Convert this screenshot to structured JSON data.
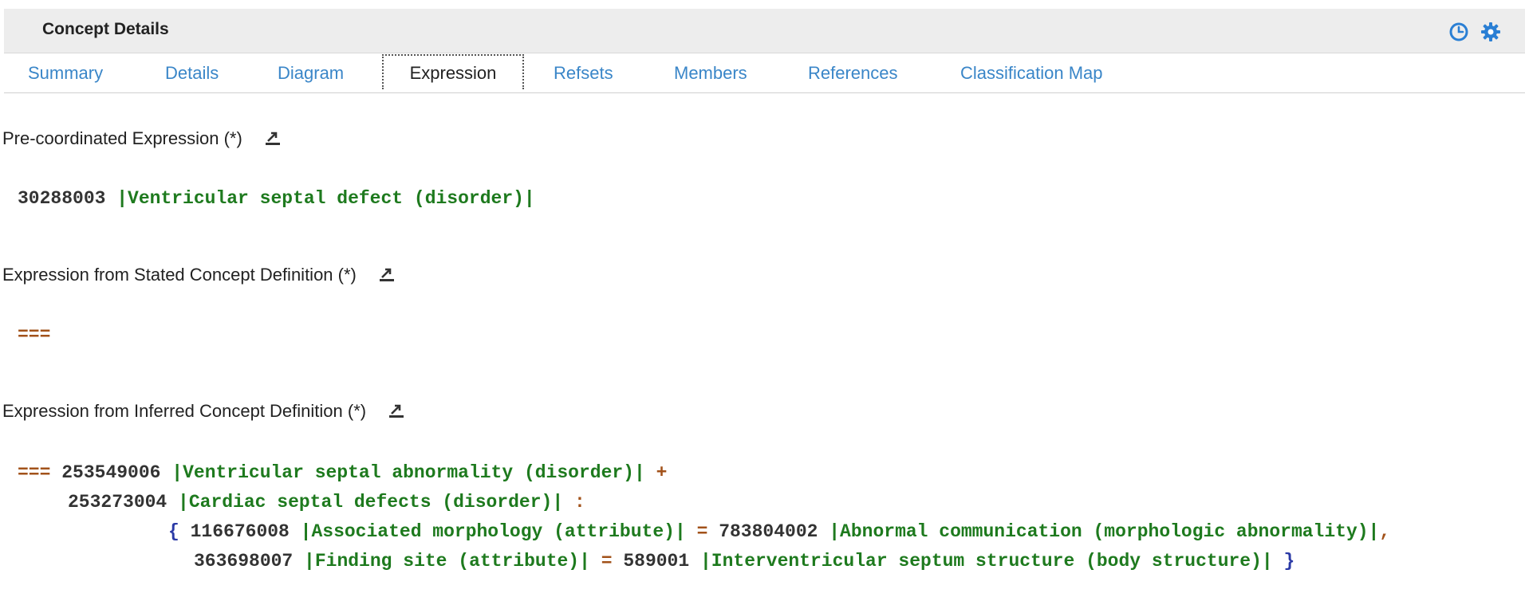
{
  "header": {
    "title": "Concept Details",
    "history_icon": "clock-icon",
    "settings_icon": "gear-icon"
  },
  "tabs": [
    {
      "label": "Summary"
    },
    {
      "label": "Details"
    },
    {
      "label": "Diagram"
    },
    {
      "label": "Expression",
      "active": true
    },
    {
      "label": "Refsets"
    },
    {
      "label": "Members"
    },
    {
      "label": "References"
    },
    {
      "label": "Classification Map"
    }
  ],
  "sections": {
    "precoordinated": {
      "label": "Pre-coordinated Expression (*)",
      "id": "30288003",
      "term": "|Ventricular septal defect (disorder)|"
    },
    "stated": {
      "label": "Expression from Stated Concept Definition (*)",
      "operator": "==="
    },
    "inferred": {
      "label": "Expression from Inferred Concept Definition (*)",
      "operator": "===",
      "parents": [
        {
          "id": "253549006",
          "term": "|Ventricular septal abnormality (disorder)|",
          "suffix": "+"
        },
        {
          "id": "253273004",
          "term": "|Cardiac septal defects (disorder)|",
          "suffix": ":"
        }
      ],
      "open_brace": "{",
      "close_brace": "}",
      "attributes": [
        {
          "attr_id": "116676008",
          "attr_term": "|Associated morphology (attribute)|",
          "equals": "=",
          "value_id": "783804002",
          "value_term": "|Abnormal communication (morphologic abnormality)|",
          "suffix": ","
        },
        {
          "attr_id": "363698007",
          "attr_term": "|Finding site (attribute)|",
          "equals": "=",
          "value_id": "589001",
          "value_term": "|Interventricular septum structure (body structure)|"
        }
      ]
    }
  },
  "colors": {
    "tab_link": "#3a86c8",
    "term": "#1e7a1e",
    "operator": "#a2521a",
    "brace": "#2b3aa6"
  }
}
